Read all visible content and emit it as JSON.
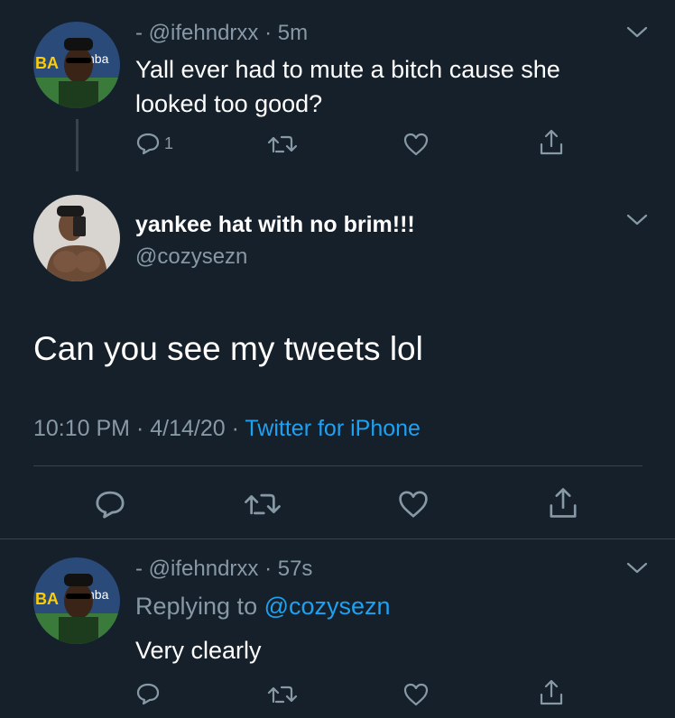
{
  "tweets": [
    {
      "handle_line": "- @ifehndrxx",
      "time": "5m",
      "text_line1": "Yall ever had to mute a bitch cause she",
      "text_line2": "looked too good?",
      "reply_count": "1"
    },
    {
      "display_name": "yankee hat with no brim!!!",
      "handle": "@cozysezn",
      "text": "Can you see my tweets lol",
      "timestamp": "10:10 PM · 4/14/20",
      "source": "Twitter for iPhone"
    },
    {
      "handle_line": "- @ifehndrxx",
      "time": "57s",
      "replying_label": "Replying to",
      "replying_handle": "@cozysezn",
      "text": "Very clearly"
    }
  ],
  "icons": {
    "reply": "reply-icon",
    "retweet": "retweet-icon",
    "like": "heart-icon",
    "share": "share-icon",
    "more": "chevron-down-icon"
  },
  "colors": {
    "background": "#15202b",
    "muted": "#8899a6",
    "accent": "#1da1f2",
    "divider": "#38444d"
  }
}
